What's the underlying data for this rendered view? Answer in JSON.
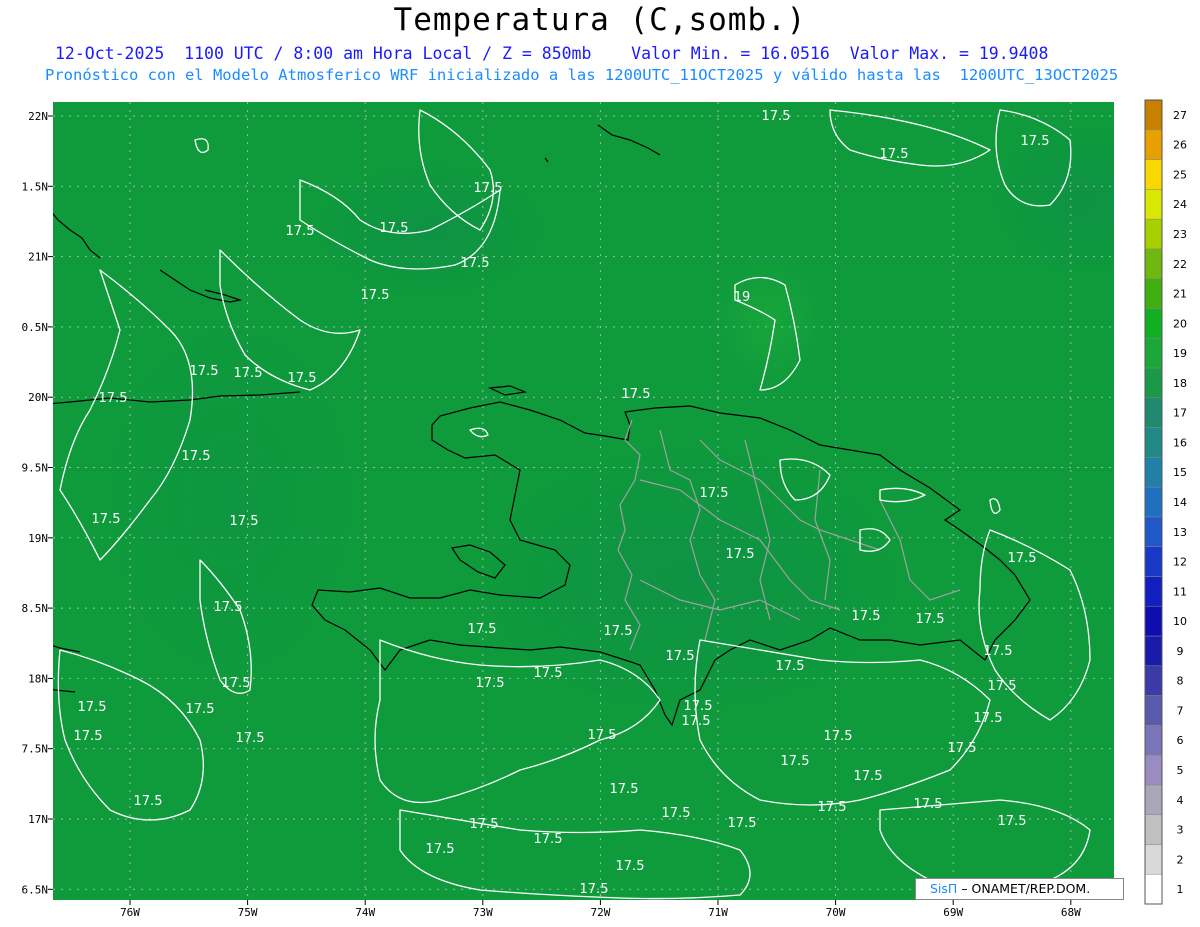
{
  "header": {
    "title": "Temperatura (C,somb.)",
    "subtitle_line1": "12-Oct-2025  1100 UTC / 8:00 am Hora Local / Z = 850mb    Valor Min. = 16.0516  Valor Max. = 19.9408",
    "subtitle_line2": "Pronóstico con el Modelo Atmosferico WRF inicializado a las 1200UTC_11OCT2025 y válido hasta las  1200UTC_13OCT2025"
  },
  "axes": {
    "lat_labels": [
      "22N",
      "1.5N",
      "21N",
      "0.5N",
      "20N",
      "9.5N",
      "19N",
      "8.5N",
      "18N",
      "7.5N",
      "17N",
      "6.5N"
    ],
    "lon_labels": [
      "76W",
      "75W",
      "74W",
      "73W",
      "72W",
      "71W",
      "70W",
      "69W",
      "68W"
    ]
  },
  "colorbar": {
    "levels": [
      "1",
      "2",
      "3",
      "4",
      "5",
      "6",
      "7",
      "8",
      "9",
      "10",
      "11",
      "12",
      "13",
      "14",
      "15",
      "16",
      "17",
      "18",
      "19",
      "20",
      "21",
      "22",
      "23",
      "24",
      "25",
      "26",
      "27"
    ],
    "colors": [
      "#ffffff",
      "#d9d9d9",
      "#c0c0c0",
      "#a8a8b8",
      "#9a8cc0",
      "#7a74b8",
      "#5a5aaa",
      "#3a3aa8",
      "#1a1aa8",
      "#0d0db0",
      "#1020c0",
      "#1838c8",
      "#2058c8",
      "#2070c0",
      "#2080a8",
      "#208a88",
      "#208a70",
      "#1a9a48",
      "#1aa83a",
      "#10b020",
      "#40b010",
      "#70b810",
      "#a8d000",
      "#d8e800",
      "#f8d800",
      "#e8a000",
      "#c88000"
    ],
    "field_color": "#0f9a3c"
  },
  "contours": {
    "label_value": "17.5",
    "label_value_19": "19"
  },
  "credit": {
    "brand": "SisΠ",
    "text": "– ONAMET/REP.DOM."
  }
}
